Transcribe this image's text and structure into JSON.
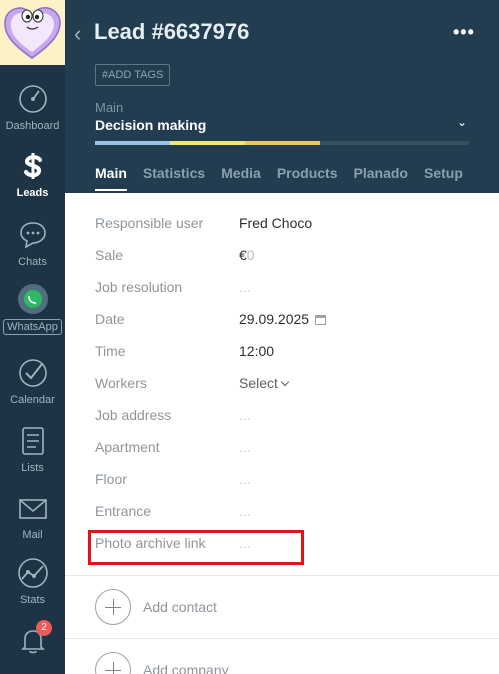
{
  "nav": {
    "items": [
      {
        "label": "Dashboard"
      },
      {
        "label": "Leads"
      },
      {
        "label": "Chats"
      },
      {
        "label": "WhatsApp"
      },
      {
        "label": "Calendar"
      },
      {
        "label": "Lists"
      },
      {
        "label": "Mail"
      },
      {
        "label": "Stats"
      }
    ],
    "notifications_count": "2"
  },
  "header": {
    "title": "Lead #6637976",
    "add_tags_label": "#ADD TAGS",
    "pipeline_label": "Main",
    "stage_name": "Decision making",
    "stage_colors": [
      "#9cc3ea",
      "#f2e67a",
      "#f0c36b"
    ]
  },
  "tabs": [
    {
      "label": "Main"
    },
    {
      "label": "Statistics"
    },
    {
      "label": "Media"
    },
    {
      "label": "Products"
    },
    {
      "label": "Planado"
    },
    {
      "label": "Setup"
    }
  ],
  "fields": [
    {
      "label": "Responsible user",
      "value": "Fred Choco"
    },
    {
      "label": "Sale",
      "value": "€",
      "value_suffix": "0"
    },
    {
      "label": "Job resolution",
      "value": "..."
    },
    {
      "label": "Date",
      "value": "29.09.2025"
    },
    {
      "label": "Time",
      "value": "12:00"
    },
    {
      "label": "Workers",
      "value": "Select"
    },
    {
      "label": "Job address",
      "value": "..."
    },
    {
      "label": "Apartment",
      "value": "..."
    },
    {
      "label": "Floor",
      "value": "..."
    },
    {
      "label": "Entrance",
      "value": "..."
    },
    {
      "label": "Photo archive link",
      "value": "..."
    }
  ],
  "actions": {
    "add_contact": "Add contact",
    "add_company": "Add company"
  }
}
